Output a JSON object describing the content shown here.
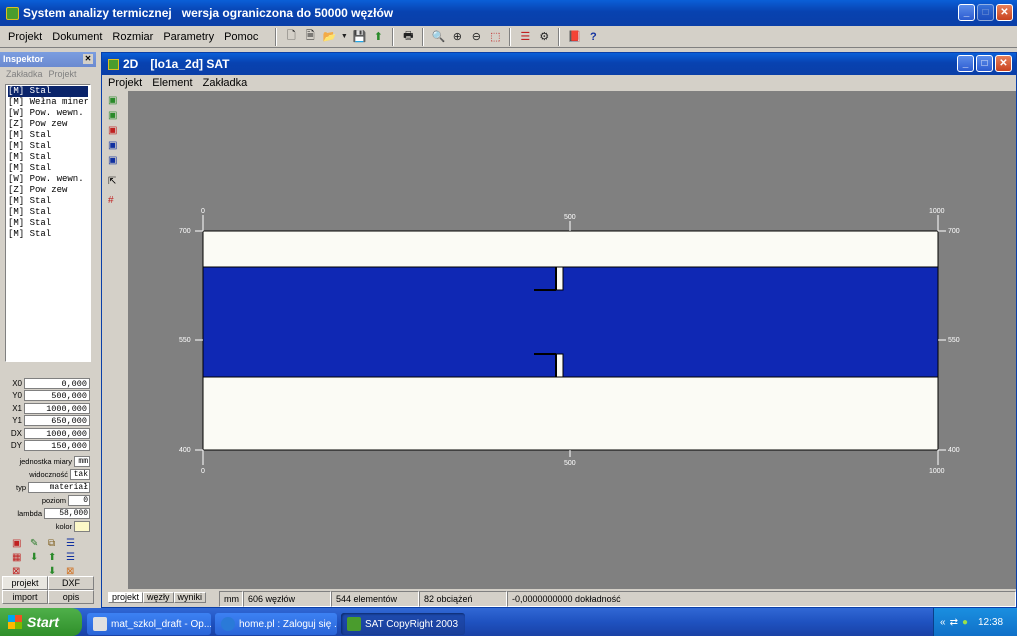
{
  "app": {
    "title": "System analizy termicznej",
    "title_extra": "wersja ograniczona do 50000 węzłów",
    "menu": [
      "Projekt",
      "Dokument",
      "Rozmiar",
      "Parametry",
      "Pomoc"
    ]
  },
  "inspector": {
    "title": "Inspektor",
    "tabs": [
      "Zakładka",
      "Projekt"
    ],
    "items": [
      "[M] Stal",
      "[M] Wełna mineralna",
      "[W] Pow. wewn.",
      "[Z] Pow zew",
      "[M] Stal",
      "[M] Stal",
      "[M] Stal",
      "[M] Stal",
      "[W] Pow. wewn.",
      "[Z] Pow zew",
      "[M] Stal",
      "[M] Stal",
      "[M] Stal",
      "[M] Stal"
    ],
    "coords": [
      {
        "label": "X0",
        "value": "0,000"
      },
      {
        "label": "Y0",
        "value": "500,000"
      },
      {
        "label": "X1",
        "value": "1000,000"
      },
      {
        "label": "Y1",
        "value": "650,000"
      },
      {
        "label": "DX",
        "value": "1000,000"
      },
      {
        "label": "DY",
        "value": "150,000"
      }
    ],
    "props": [
      {
        "label": "jednostka miary",
        "value": "mm"
      },
      {
        "label": "widoczność",
        "value": "tak"
      },
      {
        "label": "typ",
        "value": "materiał"
      },
      {
        "label": "poziom",
        "value": "0"
      },
      {
        "label": "lambda",
        "value": "58,000"
      },
      {
        "label": "kolor",
        "value": ""
      }
    ],
    "bottom_tabs": [
      "projekt",
      "DXF",
      "import",
      "opis"
    ]
  },
  "doc": {
    "title_prefix": "2D",
    "title": "[lo1a_2d] SAT",
    "menu": [
      "Projekt",
      "Element",
      "Zakładka"
    ],
    "tabs": [
      "projekt",
      "węzły",
      "wyniki"
    ],
    "status": {
      "unit": "mm",
      "nodes": "606 węzłów",
      "elements": "544 elementów",
      "loads": "82 obciążeń",
      "accuracy": "-0,0000000000 dokładność"
    }
  },
  "drawing": {
    "x_ticks": [
      "0",
      "500",
      "1000"
    ],
    "y_ticks": [
      "700",
      "550",
      "400"
    ],
    "colors": {
      "steel": "#0f28b4",
      "background": "#fbfbf5",
      "canvas": "#808080"
    }
  },
  "taskbar": {
    "start": "Start",
    "tasks": [
      "mat_szkol_draft - Op...",
      "home.pl : Zaloguj się ...",
      "SAT CopyRight 2003"
    ],
    "clock": "12:38"
  }
}
